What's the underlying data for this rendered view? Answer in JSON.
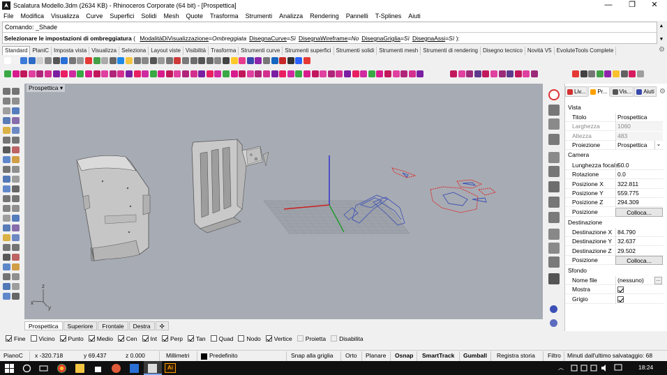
{
  "window": {
    "title": "Scalatura Modello.3dm (2634 KB) - Rhinoceros Corporate (64 bit) - [Prospettica]",
    "minimize_glyph": "—",
    "maximize_glyph": "❐",
    "close_glyph": "✕"
  },
  "menu": [
    "File",
    "Modifica",
    "Visualizza",
    "Curve",
    "Superfici",
    "Solidi",
    "Mesh",
    "Quote",
    "Trasforma",
    "Strumenti",
    "Analizza",
    "Rendering",
    "Pannelli",
    "T-Splines",
    "Aiuti"
  ],
  "command": {
    "history_line": "Comando: _Shade",
    "prompt_bold": "Selezionare le impostazioni di ombreggiatura",
    "prompt_opts": [
      {
        "name": "ModalitàDiVisualizzazione",
        "value": "Ombreggiata"
      },
      {
        "name": "DisegnaCurve",
        "value": "Sì"
      },
      {
        "name": "DisegnaWireframe",
        "value": "No"
      },
      {
        "name": "DisegnaGriglia",
        "value": "Sì"
      },
      {
        "name": "DisegnaAssi",
        "value": "Sì"
      }
    ],
    "open_paren": "(",
    "close_text": "):",
    "scroll_up_glyph": "▲",
    "scroll_down_glyph": "▼"
  },
  "toolbar_tabs": [
    "Standard",
    "PlaniC",
    "Imposta vista",
    "Visualizza",
    "Seleziona",
    "Layout viste",
    "Visibilità",
    "Trasforma",
    "Strumenti curve",
    "Strumenti superfici",
    "Strumenti solidi",
    "Strumenti mesh",
    "Strumenti di rendering",
    "Disegno tecnico",
    "Novità V5",
    "EvoluteTools Complete"
  ],
  "toolbar_settings_glyph": "⚙",
  "viewport": {
    "label": "Prospettica",
    "menu_glyph": "▾",
    "axis_labels": {
      "z": "z",
      "x": "x",
      "y": "y"
    }
  },
  "viewport_tabs": [
    "Prospettica",
    "Superiore",
    "Frontale",
    "Destra"
  ],
  "viewport_add_glyph": "✣",
  "osnaps": [
    {
      "label": "Fine",
      "checked": true
    },
    {
      "label": "Vicino",
      "checked": false
    },
    {
      "label": "Punto",
      "checked": true
    },
    {
      "label": "Medio",
      "checked": true
    },
    {
      "label": "Cen",
      "checked": true
    },
    {
      "label": "Int",
      "checked": true
    },
    {
      "label": "Perp",
      "checked": true
    },
    {
      "label": "Tan",
      "checked": true
    },
    {
      "label": "Quad",
      "checked": false
    },
    {
      "label": "Nodo",
      "checked": false
    },
    {
      "label": "Vertice",
      "checked": true
    },
    {
      "label": "Proietta",
      "checked": false,
      "disabled": true
    },
    {
      "label": "Disabilita",
      "checked": false,
      "disabled": true
    }
  ],
  "status": {
    "cplane": "PianoC",
    "x": "x -320.718",
    "y": "y 69.437",
    "z": "z 0.000",
    "units": "Millimetri",
    "layer": "Predefinito",
    "snap": "Snap alla griglia",
    "ortho": "Orto",
    "planar": "Planare",
    "osnap": "Osnap",
    "smarttrack": "SmartTrack",
    "gumball": "Gumball",
    "history": "Registra storia",
    "filter": "Filtro",
    "saved": "Minuti dall'ultimo salvataggio: 68"
  },
  "right_panel": {
    "tabs": [
      "Liv...",
      "Pr...",
      "Vis...",
      "Aiuti"
    ],
    "settings_glyph": "⚙",
    "sections": {
      "vista": "Vista",
      "camera": "Camera",
      "destinazione": "Destinazione",
      "sfondo": "Sfondo"
    },
    "vista_rows": [
      {
        "label": "Titolo",
        "value": "Prospettica"
      },
      {
        "label": "Larghezza",
        "value": "1060"
      },
      {
        "label": "Altezza",
        "value": "483"
      },
      {
        "label": "Proiezione",
        "value": "Prospettica"
      }
    ],
    "camera_rows": [
      {
        "label": "Lunghezza focale",
        "value": "50.0"
      },
      {
        "label": "Rotazione",
        "value": "0.0"
      },
      {
        "label": "Posizione X",
        "value": "322.811"
      },
      {
        "label": "Posizione Y",
        "value": "559.775"
      },
      {
        "label": "Posizione Z",
        "value": "294.309"
      },
      {
        "label": "Posizione",
        "value": "Colloca..."
      }
    ],
    "dest_rows": [
      {
        "label": "Destinazione X",
        "value": "84.790"
      },
      {
        "label": "Destinazione Y",
        "value": "32.637"
      },
      {
        "label": "Destinazione Z",
        "value": "29.502"
      },
      {
        "label": "Posizione",
        "value": "Colloca..."
      }
    ],
    "sfondo_rows": [
      {
        "label": "Nome file",
        "value": "(nessuno)"
      },
      {
        "label": "Mostra",
        "value": ""
      },
      {
        "label": "Grigio",
        "value": ""
      }
    ],
    "browse_glyph": "...",
    "dropdown_glyph": "⌄"
  },
  "taskbar": {
    "time": "18:24",
    "ai_label": "Ai"
  },
  "colors": {
    "viewport_bg": "#a7abb3",
    "model_gray": "#c9cac9",
    "curve_red": "#e02020",
    "curve_blue": "#3a4fb5",
    "axis_red": "#cc1f1f",
    "axis_green": "#1a9a2a",
    "axis_blue": "#2a2ad0"
  }
}
